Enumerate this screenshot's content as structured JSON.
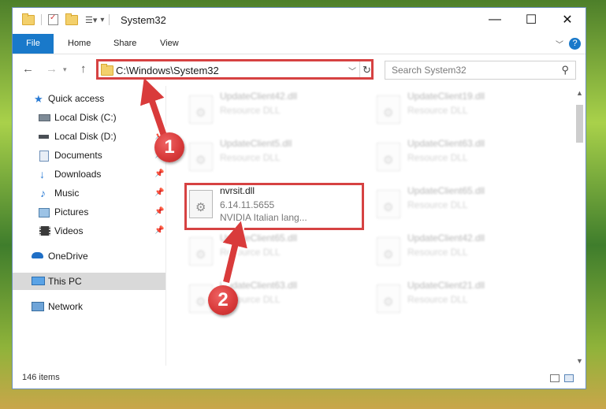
{
  "window": {
    "title": "System32",
    "controls": {
      "minimize": "—",
      "maximize": "☐",
      "close": "✕"
    }
  },
  "ribbon": {
    "tabs": [
      "File",
      "Home",
      "Share",
      "View"
    ],
    "help": "?"
  },
  "address": {
    "path": "C:\\Windows\\System32",
    "search_placeholder": "Search System32"
  },
  "sidebar": {
    "items": [
      {
        "label": "Quick access",
        "icon": "star-icon"
      },
      {
        "label": "Local Disk (C:)",
        "icon": "drive-icon"
      },
      {
        "label": "Local Disk (D:)",
        "icon": "drive-icon"
      },
      {
        "label": "Documents",
        "icon": "documents-icon"
      },
      {
        "label": "Downloads",
        "icon": "download-icon"
      },
      {
        "label": "Music",
        "icon": "music-icon"
      },
      {
        "label": "Pictures",
        "icon": "pictures-icon"
      },
      {
        "label": "Videos",
        "icon": "videos-icon"
      },
      {
        "label": "OneDrive",
        "icon": "cloud-icon"
      },
      {
        "label": "This PC",
        "icon": "computer-icon"
      },
      {
        "label": "Network",
        "icon": "network-icon"
      }
    ]
  },
  "files": {
    "col1": [
      {
        "name": "UpdateClient42.dll",
        "line2": "Resource DLL"
      },
      {
        "name": "UpdateClient5.dll",
        "line2": "Resource DLL"
      },
      {
        "name": "nvrsit.dll",
        "line2": "6.14.11.5655",
        "line3": "NVIDIA Italian lang..."
      },
      {
        "name": "UpdateClient65.dll",
        "line2": "Resource DLL"
      },
      {
        "name": "UpdateClient63.dll",
        "line2": "Resource DLL"
      }
    ],
    "col2": [
      {
        "name": "UpdateClient19.dll",
        "line2": "Resource DLL"
      },
      {
        "name": "UpdateClient63.dll",
        "line2": "Resource DLL"
      },
      {
        "name": "UpdateClient65.dll",
        "line2": "Resource DLL"
      },
      {
        "name": "UpdateClient42.dll",
        "line2": "Resource DLL"
      },
      {
        "name": "UpdateClient21.dll",
        "line2": "Resource DLL"
      }
    ]
  },
  "status": {
    "items_count": "146 items"
  },
  "callouts": {
    "step1": "1",
    "step2": "2"
  },
  "colors": {
    "highlight": "#d64242",
    "accent": "#1979ca"
  }
}
